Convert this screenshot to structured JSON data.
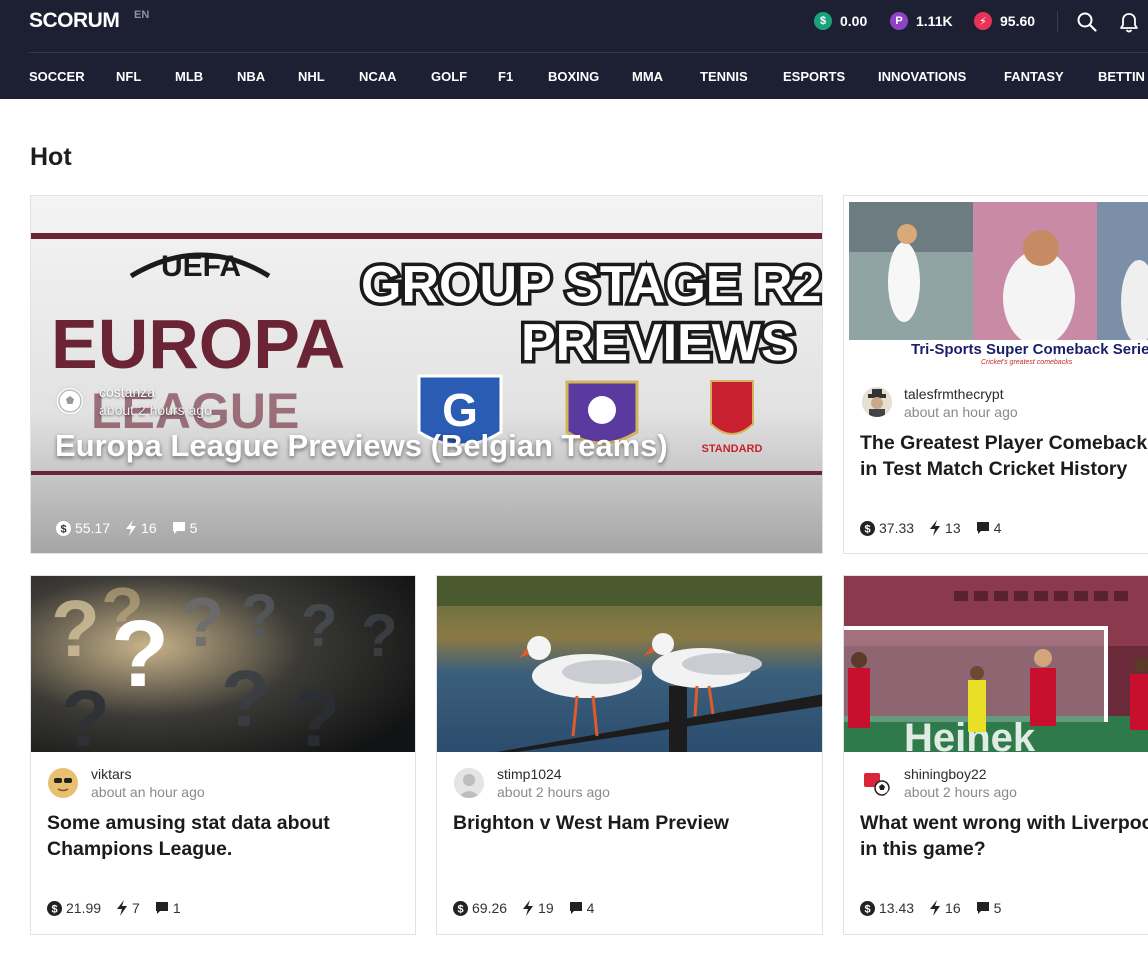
{
  "header": {
    "logo": "SCORUM",
    "lang": "EN",
    "balances": [
      {
        "icon": "dollar-coin-icon",
        "symbol": "$",
        "value": "0.00",
        "color": "#1aa37a"
      },
      {
        "icon": "power-coin-icon",
        "symbol": "P",
        "value": "1.11K",
        "color": "#8e44c2"
      },
      {
        "icon": "energy-coin-icon",
        "symbol": "⚡",
        "value": "95.60",
        "color": "#e8325a"
      }
    ]
  },
  "nav": [
    "SOCCER",
    "NFL",
    "MLB",
    "NBA",
    "NHL",
    "NCAA",
    "GOLF",
    "F1",
    "BOXING",
    "MMA",
    "TENNIS",
    "ESPORTS",
    "INNOVATIONS",
    "FANTASY",
    "BETTIN"
  ],
  "section": {
    "title": "Hot"
  },
  "posts": [
    {
      "author": "costanza",
      "time": "about 2 hours ago",
      "title": "Europa League Previews (Belgian Teams)",
      "payout": "55.17",
      "votes": "16",
      "comments": "5",
      "image_text": {
        "uefa": "UEFA",
        "europa": "EUROPA",
        "league": "LEAGUE",
        "banner1": "GROUP STAGE R2",
        "banner2": "PREVIEWS",
        "standard": "STANDARD"
      }
    },
    {
      "author": "talesfrmthecrypt",
      "time": "about an hour ago",
      "title": "The Greatest Player Comebacks in Test Match Cricket History",
      "payout": "37.33",
      "votes": "13",
      "comments": "4",
      "image_text": {
        "caption": "Tri-Sports Super Comeback Series",
        "subcaption": "Cricket's greatest comebacks"
      }
    },
    {
      "author": "viktars",
      "time": "about an hour ago",
      "title": "Some amusing stat data about Champions League.",
      "payout": "21.99",
      "votes": "7",
      "comments": "1"
    },
    {
      "author": "stimp1024",
      "time": "about 2 hours ago",
      "title": "Brighton v West Ham Preview",
      "payout": "69.26",
      "votes": "19",
      "comments": "4"
    },
    {
      "author": "shiningboy22",
      "time": "about 2 hours ago",
      "title": "What went wrong with Liverpool in this game?",
      "payout": "13.43",
      "votes": "16",
      "comments": "5",
      "image_text": {
        "board": "Heinek"
      }
    }
  ]
}
